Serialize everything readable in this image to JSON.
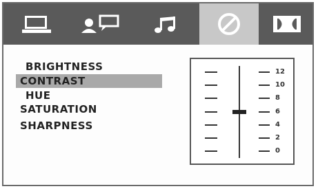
{
  "tabs": [
    {
      "icon": "monitor-icon"
    },
    {
      "icon": "user-chat-icon"
    },
    {
      "icon": "music-note-icon"
    },
    {
      "icon": "video-circle-icon",
      "active": true
    },
    {
      "icon": "dolby-icon"
    }
  ],
  "menu": {
    "items": [
      {
        "label": "BRIGHTNESS"
      },
      {
        "label": "CONTRAST",
        "selected": true
      },
      {
        "label": "HUE"
      },
      {
        "label": "SATURATION"
      },
      {
        "label": "SHARPNESS"
      }
    ]
  },
  "slider": {
    "scale_labels": [
      "12",
      "10",
      "8",
      "6",
      "4",
      "2",
      "0"
    ],
    "value": 6,
    "min": 0,
    "max": 12
  },
  "colors": {
    "tab_bar": "#5a5a5a",
    "active_tab": "#c8c8c8",
    "selection": "#a9a9a9"
  }
}
